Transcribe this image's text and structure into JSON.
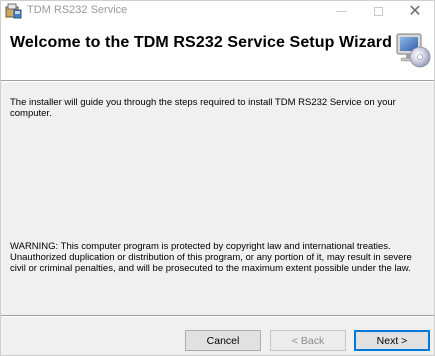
{
  "window": {
    "title": "TDM RS232 Service"
  },
  "banner": {
    "title": "Welcome to the TDM RS232 Service Setup Wizard"
  },
  "body": {
    "intro": "The installer will guide you through the steps required to install TDM RS232 Service on your computer.",
    "warning": "WARNING: This computer program is protected by copyright law and international treaties. Unauthorized duplication or distribution of this program, or any portion of it, may result in severe civil or criminal penalties, and will be prosecuted to the maximum extent possible under the law."
  },
  "buttons": {
    "cancel": "Cancel",
    "back": "< Back",
    "next": "Next >"
  },
  "state": {
    "back_enabled": false,
    "default_button": "next"
  },
  "icons": {
    "app": "installer-icon",
    "banner": "computer-cd-icon",
    "minimize": "minimize-icon",
    "maximize": "maximize-icon",
    "close": "close-icon"
  },
  "colors": {
    "accent": "#0078d7",
    "window_bg": "#f0f0f0",
    "banner_bg": "#ffffff"
  }
}
